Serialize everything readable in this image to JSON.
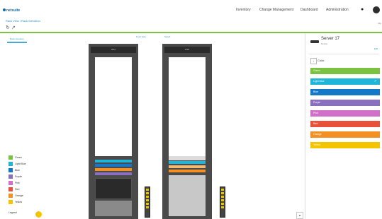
{
  "app": {
    "logo_text": "netsuite"
  },
  "nav": {
    "items": [
      "Inventory",
      "Change Management",
      "Dashboard",
      "Administration"
    ]
  },
  "breadcrumb": "Rack View / Rack Elevation",
  "right_top": "Flip",
  "tabs": {
    "active": "Rack elevation"
  },
  "toolbar_links": [
    "Front view",
    "Select"
  ],
  "racks": [
    {
      "label": "R14"
    },
    {
      "label": "R15"
    }
  ],
  "legend": [
    {
      "label": "Green",
      "color": "#7cc242"
    },
    {
      "label": "Light Blue",
      "color": "#1eb5d8"
    },
    {
      "label": "Blue",
      "color": "#1478c8"
    },
    {
      "label": "Purple",
      "color": "#8b6fbf"
    },
    {
      "label": "Pink",
      "color": "#d070c8"
    },
    {
      "label": "Red",
      "color": "#e8523a"
    },
    {
      "label": "Orange",
      "color": "#f39024"
    },
    {
      "label": "Yellow",
      "color": "#f4c400"
    }
  ],
  "legend_footer": "Legend",
  "sidebar": {
    "title": "Server 17",
    "subtitle": "Device",
    "edit": "Edit",
    "section_label": "Color",
    "colors": [
      {
        "label": "Green",
        "color": "#7cc242",
        "selected": false
      },
      {
        "label": "Light Blue",
        "color": "#1eb5d8",
        "selected": true
      },
      {
        "label": "Blue",
        "color": "#1478c8",
        "selected": false
      },
      {
        "label": "Purple",
        "color": "#8b6fbf",
        "selected": false
      },
      {
        "label": "Pink",
        "color": "#d070c8",
        "selected": false
      },
      {
        "label": "Red",
        "color": "#e8523a",
        "selected": false
      },
      {
        "label": "Orange",
        "color": "#f39024",
        "selected": false
      },
      {
        "label": "Yellow",
        "color": "#f4c400",
        "selected": false
      }
    ]
  }
}
